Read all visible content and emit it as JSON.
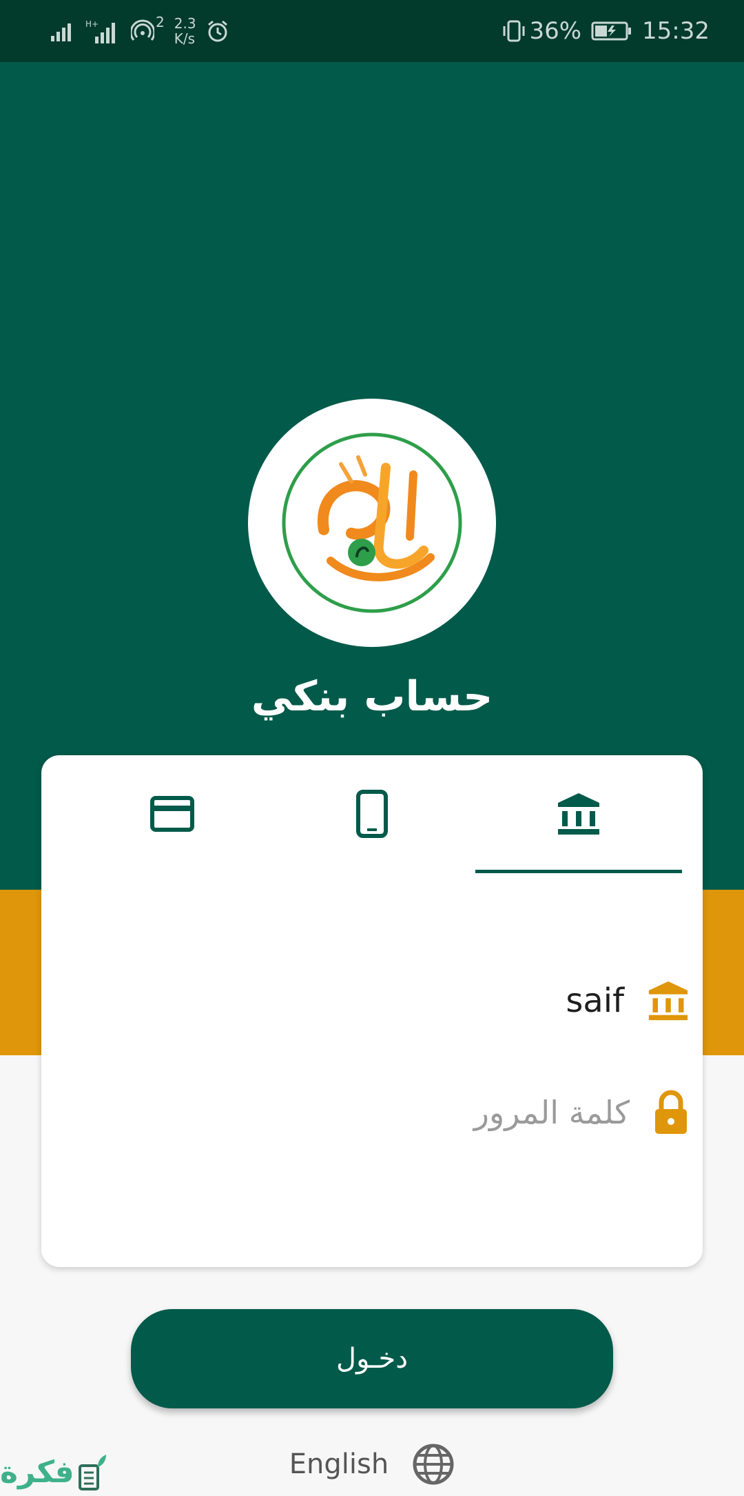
{
  "status_bar": {
    "network_speed_value": "2.3",
    "network_speed_unit": "K/s",
    "hotspot_count": "2",
    "battery": "36%",
    "time": "15:32"
  },
  "app": {
    "title": "حساب بنكي"
  },
  "tabs": [
    {
      "icon": "credit-card-icon"
    },
    {
      "icon": "phone-icon"
    },
    {
      "icon": "bank-icon",
      "active": true
    }
  ],
  "form": {
    "username_value": "saif",
    "password_placeholder": "كلمة المرور"
  },
  "login_button": {
    "label": "دخـول"
  },
  "language": {
    "label": "English"
  },
  "watermark": {
    "text": "فكرة"
  },
  "colors": {
    "primary": "#025a4a",
    "accent": "#e0960a",
    "status_bar": "#023a2c"
  }
}
